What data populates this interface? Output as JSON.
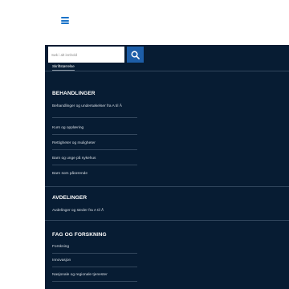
{
  "header": {
    "menu_icon": "hamburger-icon",
    "menu_color": "#1a73c9"
  },
  "search": {
    "placeholder": "Søk i alt innhold",
    "button_icon": "search-icon"
  },
  "font_size_link": "Skriftstørrelse",
  "sections": [
    {
      "title": "BEHANDLINGER",
      "items": [
        "Behandlinger og undersøkelser fra A til Å",
        "Kurs og opplæring",
        "Rettigheter og muligheter",
        "Barn og unge på sykehus",
        "Barn som pårørende"
      ]
    },
    {
      "title": "AVDELINGER",
      "items": [
        "Avdelinger og steder fra A til Å"
      ]
    },
    {
      "title": "FAG OG FORSKNING",
      "items": [
        "Forskning",
        "Innovasjon",
        "Nasjonale og regionale tjenester"
      ]
    }
  ],
  "colors": {
    "panel_bg": "#071c33",
    "search_button": "#1d5ea8",
    "text": "#ffffff"
  }
}
